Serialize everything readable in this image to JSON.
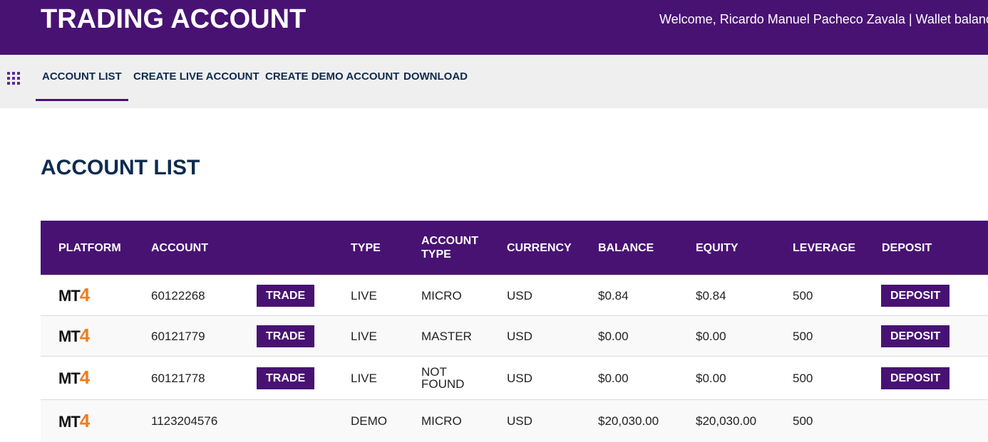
{
  "header": {
    "brand": "TRADING ACCOUNT",
    "welcome": "Welcome, Ricardo Manuel Pacheco Zavala | Wallet balance:"
  },
  "nav": {
    "menu_icon": "grid-icon",
    "items": [
      {
        "label": "ACCOUNT LIST",
        "active": true
      },
      {
        "label": "CREATE LIVE ACCOUNT",
        "active": false
      },
      {
        "label": "CREATE DEMO ACCOUNT",
        "active": false
      },
      {
        "label": "DOWNLOAD",
        "active": false
      }
    ]
  },
  "page": {
    "title": "ACCOUNT LIST"
  },
  "table": {
    "headers": {
      "platform": "PLATFORM",
      "account": "ACCOUNT",
      "type": "TYPE",
      "account_type_1": "ACCOUNT",
      "account_type_2": "TYPE",
      "currency": "CURRENCY",
      "balance": "BALANCE",
      "equity": "EQUITY",
      "leverage": "LEVERAGE",
      "deposit": "DEPOSIT"
    },
    "rows": [
      {
        "platform_mt": "MT",
        "platform_num": "4",
        "account": "60122268",
        "trade": "TRADE",
        "type": "LIVE",
        "account_type_1": "MICRO",
        "account_type_2": "",
        "currency": "USD",
        "balance": "$0.84",
        "equity": "$0.84",
        "leverage": "500",
        "deposit": "DEPOSIT"
      },
      {
        "platform_mt": "MT",
        "platform_num": "4",
        "account": "60121779",
        "trade": "TRADE",
        "type": "LIVE",
        "account_type_1": "MASTER",
        "account_type_2": "",
        "currency": "USD",
        "balance": "$0.00",
        "equity": "$0.00",
        "leverage": "500",
        "deposit": "DEPOSIT"
      },
      {
        "platform_mt": "MT",
        "platform_num": "4",
        "account": "60121778",
        "trade": "TRADE",
        "type": "LIVE",
        "account_type_1": "NOT",
        "account_type_2": "FOUND",
        "currency": "USD",
        "balance": "$0.00",
        "equity": "$0.00",
        "leverage": "500",
        "deposit": "DEPOSIT"
      },
      {
        "platform_mt": "MT",
        "platform_num": "4",
        "account": "1123204576",
        "trade": "",
        "type": "DEMO",
        "account_type_1": "MICRO",
        "account_type_2": "",
        "currency": "USD",
        "balance": "$20,030.00",
        "equity": "$20,030.00",
        "leverage": "500",
        "deposit": ""
      }
    ]
  },
  "colors": {
    "brand_purple": "#481273",
    "nav_text": "#0d2b4e",
    "mt4_orange": "#f07d1e"
  }
}
